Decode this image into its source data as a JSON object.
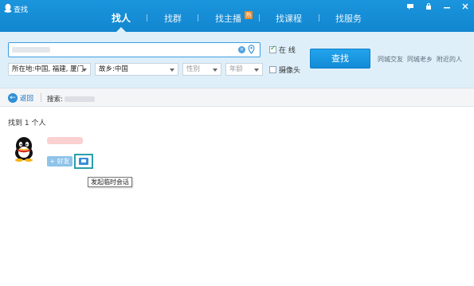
{
  "window": {
    "title": "查找",
    "controls": [
      "skin-icon",
      "lock-icon",
      "minimize-icon",
      "close-icon"
    ]
  },
  "tabs": [
    {
      "label": "找人",
      "active": true
    },
    {
      "label": "找群",
      "active": false
    },
    {
      "label": "找主播",
      "active": false,
      "badge": "热"
    },
    {
      "label": "找课程",
      "active": false
    },
    {
      "label": "找服务",
      "active": false
    }
  ],
  "search": {
    "keyword_value": "",
    "online_label": "在 线",
    "online_checked": true,
    "camera_label": "摄像头",
    "camera_checked": false,
    "button_label": "查找",
    "location_select": "所在地:中国, 福建, 厦门",
    "hometown_select": "故乡:中国",
    "gender_select": "性别",
    "age_select": "年龄",
    "quick_links": [
      "同城交友",
      "同城老乡",
      "附近的人"
    ]
  },
  "breadcrumb": {
    "back_label": "返回",
    "search_label": "搜索:"
  },
  "results": {
    "count_text": "找到 1 个人",
    "add_friend_label": "+ 好友",
    "tooltip": "发起临时会话"
  },
  "colors": {
    "header": "#1b95dd",
    "panel": "#dfeff9",
    "button": "#1896e3",
    "highlight_border": "#2a9fa9"
  }
}
